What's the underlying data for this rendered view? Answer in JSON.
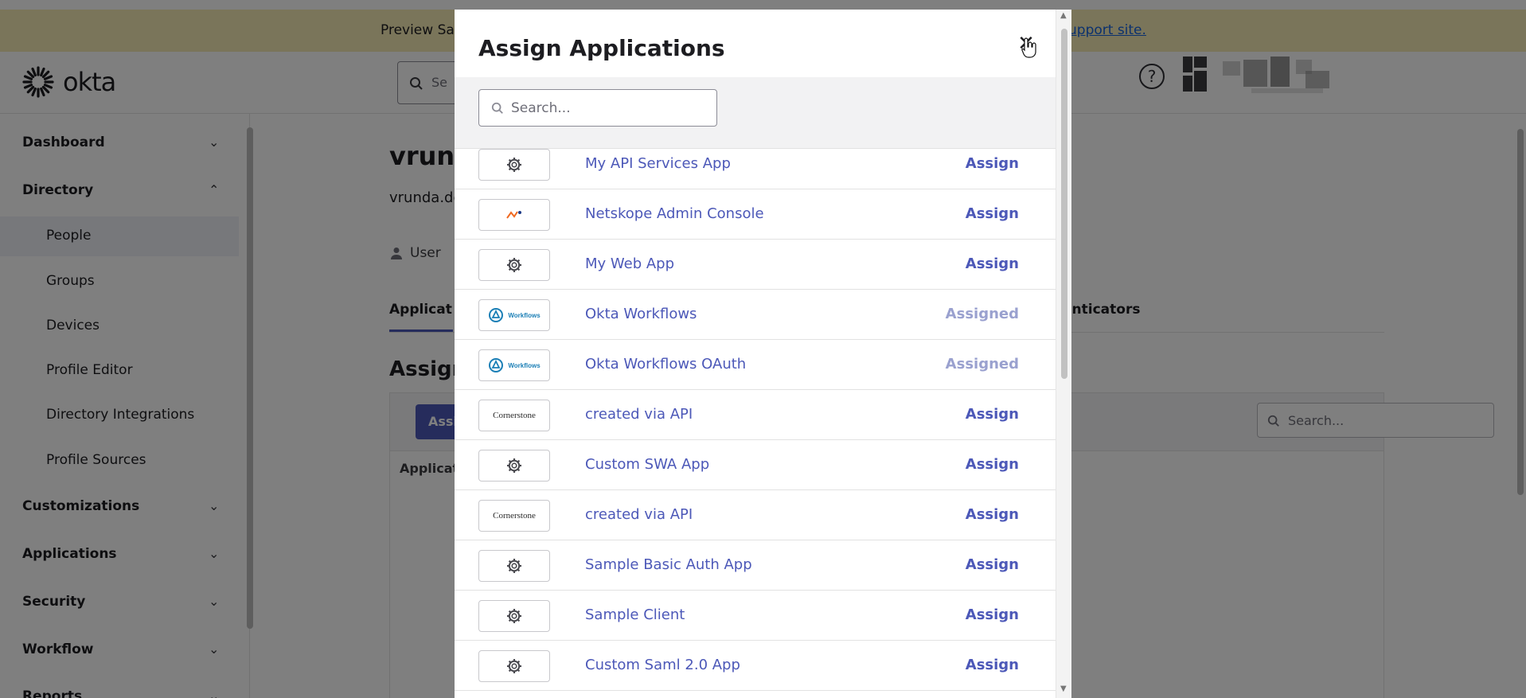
{
  "banner": {
    "left_text": "Preview Sa",
    "right_text": "upport site."
  },
  "header": {
    "logo_text": "okta",
    "search_placeholder": "Se",
    "help_label": "?"
  },
  "sidebar": {
    "items": [
      {
        "label": "Dashboard",
        "chevron": "⌄"
      },
      {
        "label": "Directory",
        "chevron": "⌃"
      },
      {
        "label": "Customizations",
        "chevron": "⌄"
      },
      {
        "label": "Applications",
        "chevron": "⌄"
      },
      {
        "label": "Security",
        "chevron": "⌄"
      },
      {
        "label": "Workflow",
        "chevron": "⌄"
      },
      {
        "label": "Reports",
        "chevron": "⌄"
      }
    ],
    "directory_children": [
      {
        "label": "People"
      },
      {
        "label": "Groups"
      },
      {
        "label": "Devices"
      },
      {
        "label": "Profile Editor"
      },
      {
        "label": "Directory Integrations"
      },
      {
        "label": "Profile Sources"
      }
    ]
  },
  "content": {
    "title": "vrunda",
    "email": "vrunda.de",
    "user_label": "User",
    "tab_applications": "Applicat",
    "tab_authenticators": "enticators",
    "assign_title": "Assign",
    "assign_button": "Assi",
    "search_placeholder": "Search...",
    "column_header": "Applicat"
  },
  "modal": {
    "title": "Assign Applications",
    "close_label": "✕",
    "search_placeholder": "Search...",
    "apps": [
      {
        "name": "My API Services App",
        "logo": "gear-icon",
        "action": "Assign",
        "assigned": false
      },
      {
        "name": "Netskope Admin Console",
        "logo": "netskope-logo",
        "action": "Assign",
        "assigned": false
      },
      {
        "name": "My Web App",
        "logo": "gear-icon",
        "action": "Assign",
        "assigned": false
      },
      {
        "name": "Okta Workflows",
        "logo": "workflows-logo",
        "action": "Assigned",
        "assigned": true
      },
      {
        "name": "Okta Workflows OAuth",
        "logo": "workflows-logo",
        "action": "Assigned",
        "assigned": true
      },
      {
        "name": "created via API",
        "logo": "cornerstone-logo",
        "action": "Assign",
        "assigned": false
      },
      {
        "name": "Custom SWA App",
        "logo": "gear-icon",
        "action": "Assign",
        "assigned": false
      },
      {
        "name": "created via API",
        "logo": "cornerstone-logo",
        "action": "Assign",
        "assigned": false
      },
      {
        "name": "Sample Basic Auth App",
        "logo": "gear-icon",
        "action": "Assign",
        "assigned": false
      },
      {
        "name": "Sample Client",
        "logo": "gear-icon",
        "action": "Assign",
        "assigned": false
      },
      {
        "name": "Custom Saml 2.0 App",
        "logo": "gear-icon",
        "action": "Assign",
        "assigned": false
      }
    ],
    "logo_texts": {
      "workflows": "Workflows",
      "cornerstone": "Cornerstone"
    }
  },
  "colors": {
    "accent": "#4c58b8",
    "assigned": "#9aa1cf",
    "banner": "#f5eab4"
  }
}
